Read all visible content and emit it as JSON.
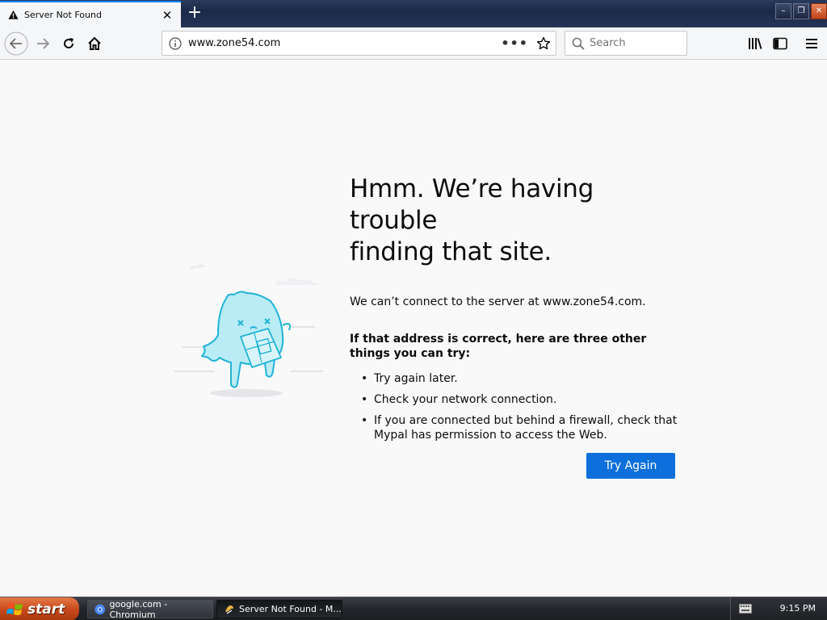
{
  "tab": {
    "title": "Server Not Found",
    "close": "✕"
  },
  "newtab": "+",
  "window": {
    "minimize": "–",
    "restore": "❐",
    "close": "✕"
  },
  "urlbar": {
    "url": "www.zone54.com",
    "page_actions": "•••"
  },
  "search": {
    "placeholder": "Search"
  },
  "error": {
    "title_line1": "Hmm. We’re having trouble",
    "title_line2": "finding that site.",
    "description": "We can’t connect to the server at www.zone54.com.",
    "subtitle": "If that address is correct, here are three other things you can try:",
    "tips": [
      "Try again later.",
      "Check your network connection.",
      "If you are connected but behind a firewall, check that Mypal has permission to access the Web."
    ],
    "button": "Try Again"
  },
  "taskbar": {
    "start": "start",
    "tasks": [
      {
        "label": "google.com - Chromium",
        "icon": "chromium-icon"
      },
      {
        "label": "Server Not Found - M...",
        "icon": "mypal-icon"
      }
    ],
    "clock": "9:15 PM"
  },
  "colors": {
    "accent": "#0c6fdb",
    "tab_highlight": "#0a84ff",
    "start": "#c84a1c"
  }
}
